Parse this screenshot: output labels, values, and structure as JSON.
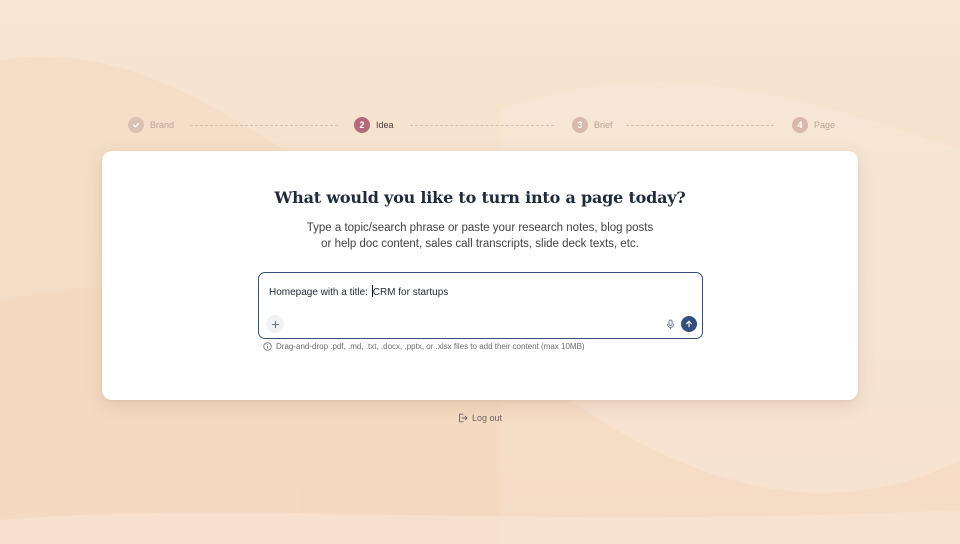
{
  "stepper": {
    "steps": [
      {
        "number": "✓",
        "label": "Brand",
        "state": "done"
      },
      {
        "number": "2",
        "label": "Idea",
        "state": "active"
      },
      {
        "number": "3",
        "label": "Brief",
        "state": "pending"
      },
      {
        "number": "4",
        "label": "Page",
        "state": "pending"
      }
    ]
  },
  "card": {
    "title": "What would you like to turn into a page today?",
    "subtitle_line1": "Type a topic/search phrase or paste your research notes, blog posts",
    "subtitle_line2": "or help doc content, sales call transcripts, slide deck texts, etc.",
    "input_value_before_caret": "Homepage with a title: ",
    "input_value_after_caret": "CRM for startups",
    "hint": "Drag-and-drop .pdf, .md, .txt, .docx, .pptx, or .xlsx files to add their content (max 10MB)"
  },
  "footer": {
    "logout_label": "Log out"
  },
  "colors": {
    "background": "#f6e3cf",
    "accent_active_step": "#b56a7a",
    "pending_step": "#d7b9a9",
    "send_button": "#354f7d",
    "input_border": "#36507a"
  },
  "icons": {
    "done_step": "check-icon",
    "add": "plus-icon",
    "mic": "microphone-icon",
    "send": "arrow-up-icon",
    "info": "info-icon",
    "logout": "logout-icon"
  }
}
